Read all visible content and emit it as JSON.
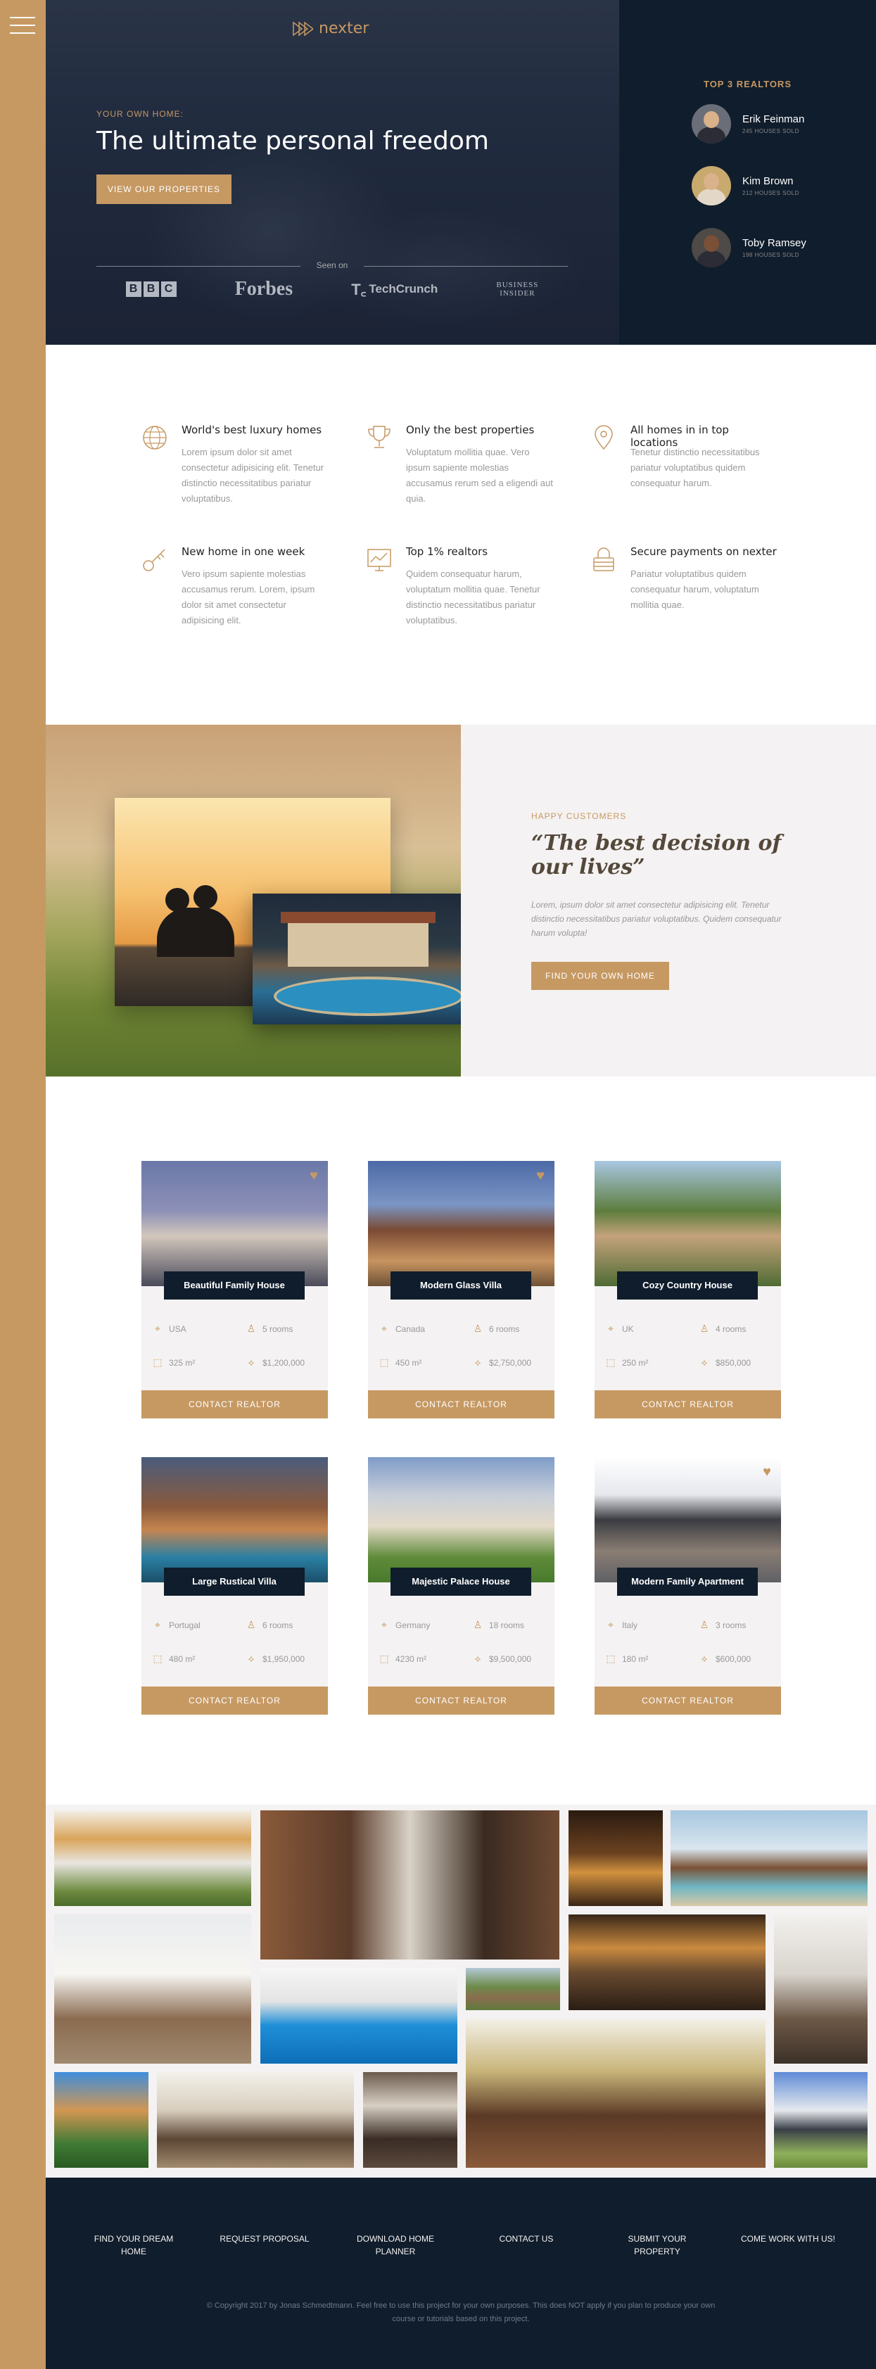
{
  "brand": {
    "name": "nexter",
    "accent": "#c69963",
    "dark": "#101d2c"
  },
  "nav": {
    "menu_icon": "hamburger-icon"
  },
  "header": {
    "subtitle": "Your own home:",
    "title": "The ultimate personal freedom",
    "cta": "View our properties",
    "seen_on": "Seen on",
    "press": {
      "bbc": [
        "B",
        "B",
        "C"
      ],
      "forbes": "Forbes",
      "techcrunch": "TechCrunch",
      "bi_line1": "BUSINESS",
      "bi_line2": "INSIDER"
    }
  },
  "realtors": {
    "title": "Top 3 Realtors",
    "list": [
      {
        "name": "Erik Feinman",
        "sold": "245 houses sold"
      },
      {
        "name": "Kim Brown",
        "sold": "212 houses sold"
      },
      {
        "name": "Toby Ramsey",
        "sold": "198 houses sold"
      }
    ]
  },
  "features": [
    {
      "icon": "globe-icon",
      "title": "World's best luxury homes",
      "text": "Lorem ipsum dolor sit amet consectetur adipisicing elit. Tenetur distinctio necessitatibus pariatur voluptatibus."
    },
    {
      "icon": "trophy-icon",
      "title": "Only the best properties",
      "text": "Voluptatum mollitia quae. Vero ipsum sapiente molestias accusamus rerum sed a eligendi aut quia."
    },
    {
      "icon": "map-pin-icon",
      "title": "All homes in in top locations",
      "text": "Tenetur distinctio necessitatibus pariatur voluptatibus quidem consequatur harum."
    },
    {
      "icon": "key-icon",
      "title": "New home in one week",
      "text": "Vero ipsum sapiente molestias accusamus rerum. Lorem, ipsum dolor sit amet consectetur adipisicing elit."
    },
    {
      "icon": "chart-icon",
      "title": "Top 1% realtors",
      "text": "Quidem consequatur harum, voluptatum mollitia quae. Tenetur distinctio necessitatibus pariatur voluptatibus."
    },
    {
      "icon": "lock-icon",
      "title": "Secure payments on nexter",
      "text": "Pariatur voluptatibus quidem consequatur harum, voluptatum mollitia quae."
    }
  ],
  "story": {
    "subtitle": "Happy Customers",
    "title": "“The best decision of our lives”",
    "text": "Lorem, ipsum dolor sit amet consectetur adipisicing elit. Tenetur distinctio necessitatibus pariatur voluptatibus. Quidem consequatur harum volupta!",
    "cta": "Find your own home"
  },
  "homes": [
    {
      "name": "Beautiful Family House",
      "location": "USA",
      "rooms": "5 rooms",
      "area": "325 m²",
      "price": "$1,200,000",
      "cta": "Contact realtor"
    },
    {
      "name": "Modern Glass Villa",
      "location": "Canada",
      "rooms": "6 rooms",
      "area": "450 m²",
      "price": "$2,750,000",
      "cta": "Contact realtor"
    },
    {
      "name": "Cozy Country House",
      "location": "UK",
      "rooms": "4 rooms",
      "area": "250 m²",
      "price": "$850,000",
      "cta": "Contact realtor"
    },
    {
      "name": "Large Rustical Villa",
      "location": "Portugal",
      "rooms": "6 rooms",
      "area": "480 m²",
      "price": "$1,950,000",
      "cta": "Contact realtor"
    },
    {
      "name": "Majestic Palace House",
      "location": "Germany",
      "rooms": "18 rooms",
      "area": "4230 m²",
      "price": "$9,500,000",
      "cta": "Contact realtor"
    },
    {
      "name": "Modern Family Apartment",
      "location": "Italy",
      "rooms": "3 rooms",
      "area": "180 m²",
      "price": "$600,000",
      "cta": "Contact realtor"
    }
  ],
  "footer": {
    "links": [
      {
        "line1": "Find your dream",
        "line2": "home"
      },
      {
        "line1": "Request proposal",
        "line2": ""
      },
      {
        "line1": "Download home",
        "line2": "planner"
      },
      {
        "line1": "Contact us",
        "line2": ""
      },
      {
        "line1": "Submit your",
        "line2": "property"
      },
      {
        "line1": "Come work with us!",
        "line2": ""
      }
    ],
    "copyright": "© Copyright 2017 by Jonas Schmedtmann. Feel free to use this project for your own purposes. This does NOT apply if you plan to produce your own course or tutorials based on this project."
  }
}
